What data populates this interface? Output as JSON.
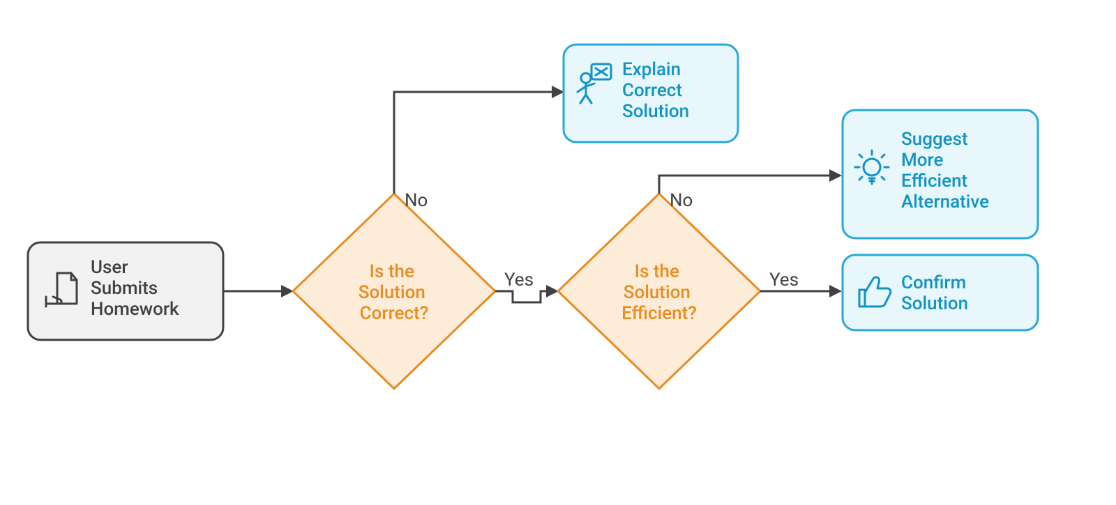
{
  "start": {
    "line1": "User",
    "line2": "Submits",
    "line3": "Homework"
  },
  "decision1": {
    "line1": "Is the",
    "line2": "Solution",
    "line3": "Correct?"
  },
  "decision2": {
    "line1": "Is the",
    "line2": "Solution",
    "line3": "Efficient?"
  },
  "outcome_explain": {
    "line1": "Explain",
    "line2": "Correct",
    "line3": "Solution"
  },
  "outcome_suggest": {
    "line1": "Suggest",
    "line2": "More",
    "line3": "Efficient",
    "line4": "Alternative"
  },
  "outcome_confirm": {
    "line1": "Confirm",
    "line2": "Solution"
  },
  "labels": {
    "no": "No",
    "yes": "Yes"
  },
  "colors": {
    "neutral": "#414141",
    "accent_orange": "#e98c21",
    "accent_blue": "#1193c4",
    "fill_start": "#f2f2f2",
    "fill_diamond": "#fdecd8",
    "fill_result": "#e8f7fc",
    "stroke_result": "#26a9d9"
  }
}
